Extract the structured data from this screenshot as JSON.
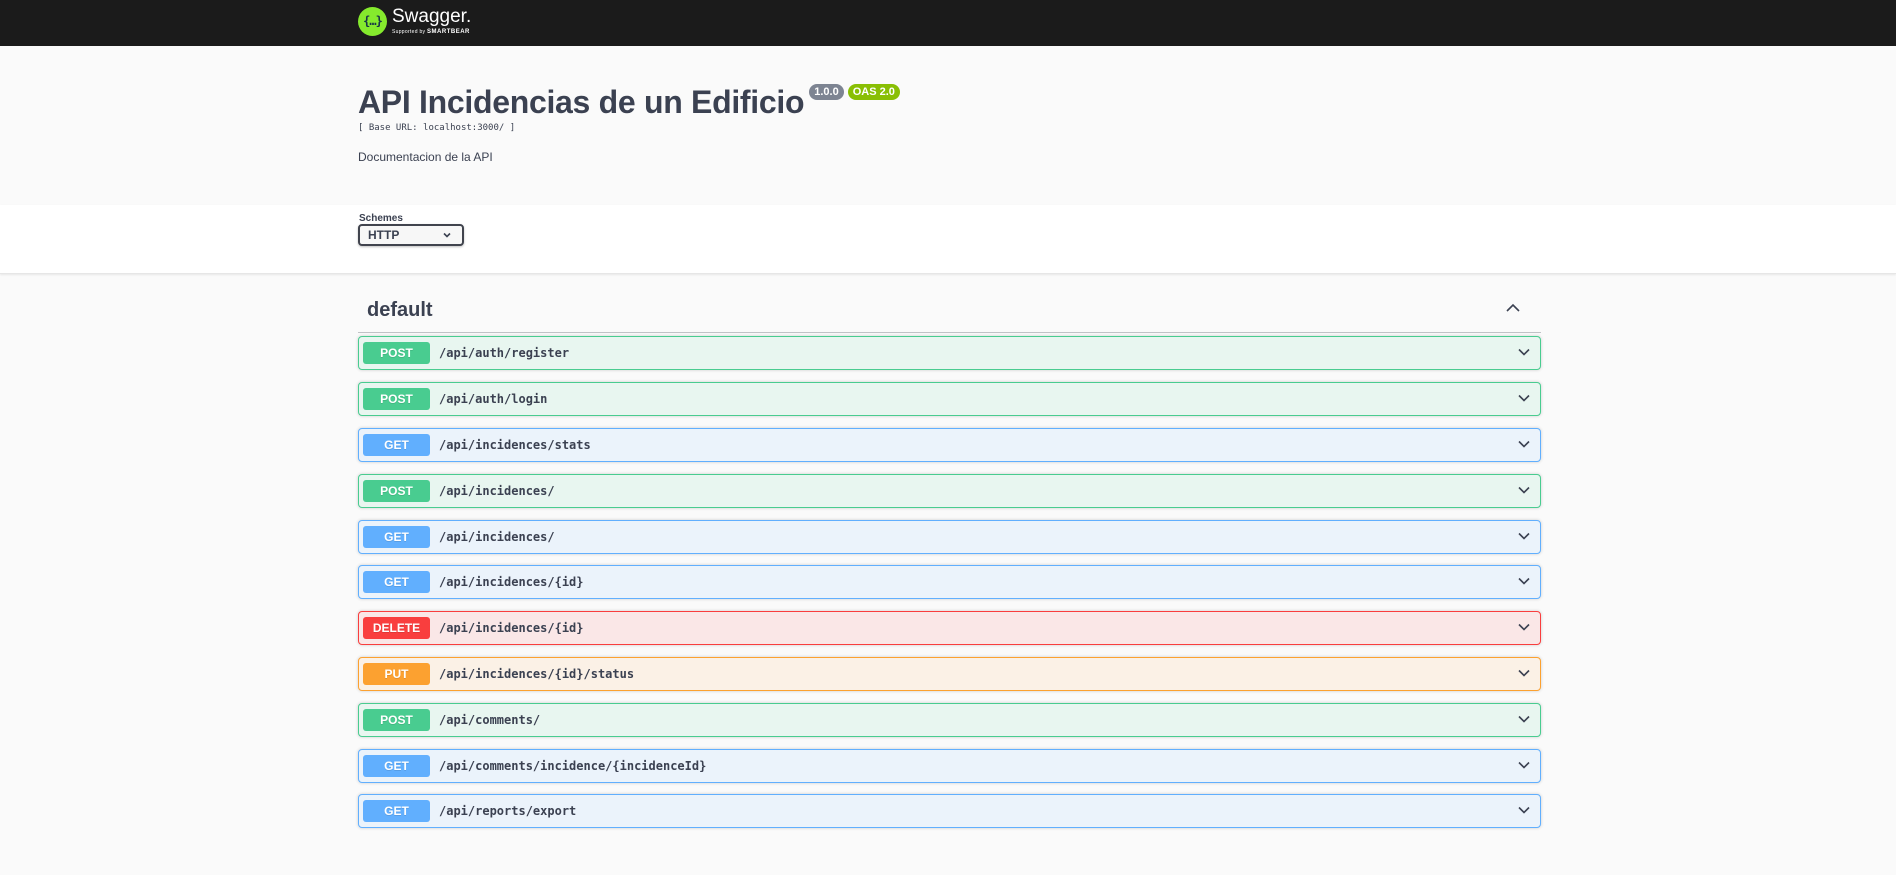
{
  "topbar": {
    "logo_symbol": "{…}",
    "logo_name": "Swagger.",
    "logo_sub_prefix": "Supported by",
    "logo_sub_brand": "SMARTBEAR"
  },
  "info": {
    "title": "API Incidencias de un Edificio",
    "version": "1.0.0",
    "oas": "OAS 2.0",
    "base_url": "[ Base URL: localhost:3000/ ]",
    "description": "Documentacion de la API"
  },
  "schemes": {
    "label": "Schemes",
    "selected": "HTTP"
  },
  "section": {
    "title": "default",
    "toggle_icon": "chevron-up-icon"
  },
  "operations": [
    {
      "method": "POST",
      "path": "/api/auth/register"
    },
    {
      "method": "POST",
      "path": "/api/auth/login"
    },
    {
      "method": "GET",
      "path": "/api/incidences/stats"
    },
    {
      "method": "POST",
      "path": "/api/incidences/"
    },
    {
      "method": "GET",
      "path": "/api/incidences/"
    },
    {
      "method": "GET",
      "path": "/api/incidences/{id}"
    },
    {
      "method": "DELETE",
      "path": "/api/incidences/{id}"
    },
    {
      "method": "PUT",
      "path": "/api/incidences/{id}/status"
    },
    {
      "method": "POST",
      "path": "/api/comments/"
    },
    {
      "method": "GET",
      "path": "/api/comments/incidence/{incidenceId}"
    },
    {
      "method": "GET",
      "path": "/api/reports/export"
    }
  ],
  "colors": {
    "post": "#49cc90",
    "get": "#61affe",
    "delete": "#f93e3e",
    "put": "#fca130",
    "topbar": "#1b1b1b",
    "logo": "#85ea2d"
  }
}
